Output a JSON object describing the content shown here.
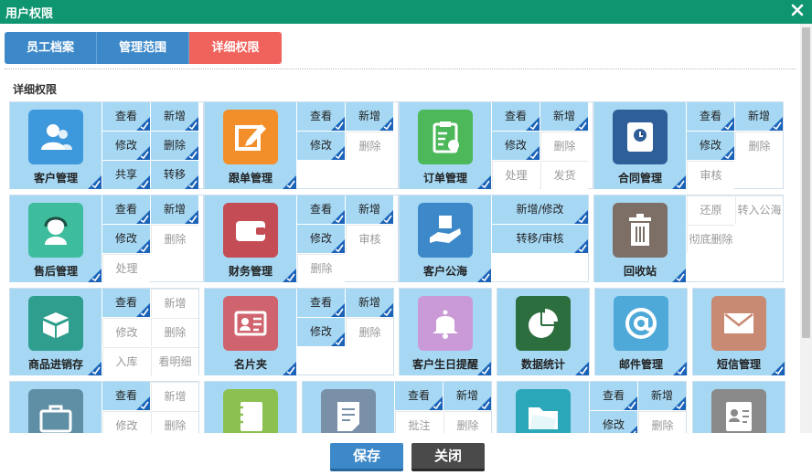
{
  "window": {
    "title": "用户权限"
  },
  "tabs": [
    {
      "label": "员工档案",
      "active": false
    },
    {
      "label": "管理范围",
      "active": false
    },
    {
      "label": "详细权限",
      "active": true
    }
  ],
  "section_title": "详细权限",
  "modules": [
    {
      "name": "客户管理",
      "icon": "users-icon",
      "color": "#3d98dc",
      "checked": true,
      "perms": [
        {
          "label": "查看",
          "on": true
        },
        {
          "label": "新增",
          "on": true
        },
        {
          "label": "修改",
          "on": true
        },
        {
          "label": "删除",
          "on": true
        },
        {
          "label": "共享",
          "on": true
        },
        {
          "label": "转移",
          "on": true
        }
      ]
    },
    {
      "name": "跟单管理",
      "icon": "edit-icon",
      "color": "#f28f2a",
      "checked": true,
      "perms": [
        {
          "label": "查看",
          "on": true
        },
        {
          "label": "新增",
          "on": true
        },
        {
          "label": "修改",
          "on": true
        },
        {
          "label": "删除",
          "on": false
        }
      ]
    },
    {
      "name": "订单管理",
      "icon": "clipboard-icon",
      "color": "#4cb85a",
      "checked": true,
      "perms": [
        {
          "label": "查看",
          "on": true
        },
        {
          "label": "新增",
          "on": true
        },
        {
          "label": "修改",
          "on": true
        },
        {
          "label": "删除",
          "on": false
        },
        {
          "label": "处理",
          "on": false
        },
        {
          "label": "发货",
          "on": false
        }
      ]
    },
    {
      "name": "合同管理",
      "icon": "contract-icon",
      "color": "#2f5f99",
      "checked": true,
      "perms": [
        {
          "label": "查看",
          "on": true
        },
        {
          "label": "新增",
          "on": true
        },
        {
          "label": "修改",
          "on": true
        },
        {
          "label": "删除",
          "on": false
        },
        {
          "label": "审核",
          "on": false
        }
      ]
    },
    {
      "name": "售后管理",
      "icon": "headset-icon",
      "color": "#3dbd9d",
      "checked": true,
      "perms": [
        {
          "label": "查看",
          "on": true
        },
        {
          "label": "新增",
          "on": true
        },
        {
          "label": "修改",
          "on": true
        },
        {
          "label": "删除",
          "on": false
        },
        {
          "label": "处理",
          "on": false
        }
      ]
    },
    {
      "name": "财务管理",
      "icon": "wallet-icon",
      "color": "#c44c55",
      "checked": true,
      "perms": [
        {
          "label": "查看",
          "on": true
        },
        {
          "label": "新增",
          "on": true
        },
        {
          "label": "修改",
          "on": true
        },
        {
          "label": "审核",
          "on": false
        },
        {
          "label": "删除",
          "on": false
        }
      ]
    },
    {
      "name": "客户公海",
      "icon": "hand-box-icon",
      "color": "#3d88c8",
      "checked": true,
      "perms": [
        {
          "label": "新增/修改",
          "on": true
        },
        {
          "label": "转移/审核",
          "on": true
        }
      ]
    },
    {
      "name": "回收站",
      "icon": "trash-icon",
      "color": "#7d6e66",
      "checked": true,
      "perms": [
        {
          "label": "还原",
          "on": false
        },
        {
          "label": "转入公海",
          "on": false
        },
        {
          "label": "彻底删除",
          "on": false
        }
      ]
    },
    {
      "name": "商品进销存",
      "icon": "box-icon",
      "color": "#2f9e8e",
      "checked": true,
      "perms": [
        {
          "label": "查看",
          "on": true
        },
        {
          "label": "新增",
          "on": false
        },
        {
          "label": "修改",
          "on": false
        },
        {
          "label": "删除",
          "on": false
        },
        {
          "label": "入库",
          "on": false
        },
        {
          "label": "看明细",
          "on": false
        }
      ]
    },
    {
      "name": "名片夹",
      "icon": "id-card-icon",
      "color": "#d0646e",
      "checked": true,
      "perms": [
        {
          "label": "查看",
          "on": true
        },
        {
          "label": "新增",
          "on": true
        },
        {
          "label": "修改",
          "on": true
        },
        {
          "label": "删除",
          "on": false
        }
      ]
    },
    {
      "name": "客户生日提醒",
      "icon": "bell-icon",
      "color": "#c99ad6",
      "checked": true,
      "perms": []
    },
    {
      "name": "数据统计",
      "icon": "pie-chart-icon",
      "color": "#2d6e3e",
      "checked": true,
      "perms": []
    },
    {
      "name": "邮件管理",
      "icon": "at-icon",
      "color": "#4fa9d8",
      "checked": true,
      "perms": []
    },
    {
      "name": "短信管理",
      "icon": "envelope-icon",
      "color": "#c88a72",
      "checked": true,
      "perms": []
    },
    {
      "name": "",
      "icon": "briefcase-icon",
      "color": "#5f8fa5",
      "checked": false,
      "perms": [
        {
          "label": "查看",
          "on": true
        },
        {
          "label": "新增",
          "on": false
        },
        {
          "label": "修改",
          "on": false
        },
        {
          "label": "删除",
          "on": false
        }
      ]
    },
    {
      "name": "",
      "icon": "notebook-icon",
      "color": "#8cc152",
      "checked": false,
      "perms": []
    },
    {
      "name": "",
      "icon": "note-icon",
      "color": "#7a8fa8",
      "checked": false,
      "perms": [
        {
          "label": "查看",
          "on": true
        },
        {
          "label": "新增",
          "on": true
        },
        {
          "label": "批注",
          "on": false
        },
        {
          "label": "删除",
          "on": false
        }
      ]
    },
    {
      "name": "",
      "icon": "folder-icon",
      "color": "#2aa7b8",
      "checked": false,
      "perms": [
        {
          "label": "查看",
          "on": true
        },
        {
          "label": "新增",
          "on": true
        },
        {
          "label": "修改",
          "on": true
        },
        {
          "label": "删除",
          "on": false
        }
      ]
    },
    {
      "name": "",
      "icon": "contact-card-icon",
      "color": "#8a8a8a",
      "checked": false,
      "perms": []
    }
  ],
  "footer": {
    "save": "保存",
    "close": "关闭"
  }
}
